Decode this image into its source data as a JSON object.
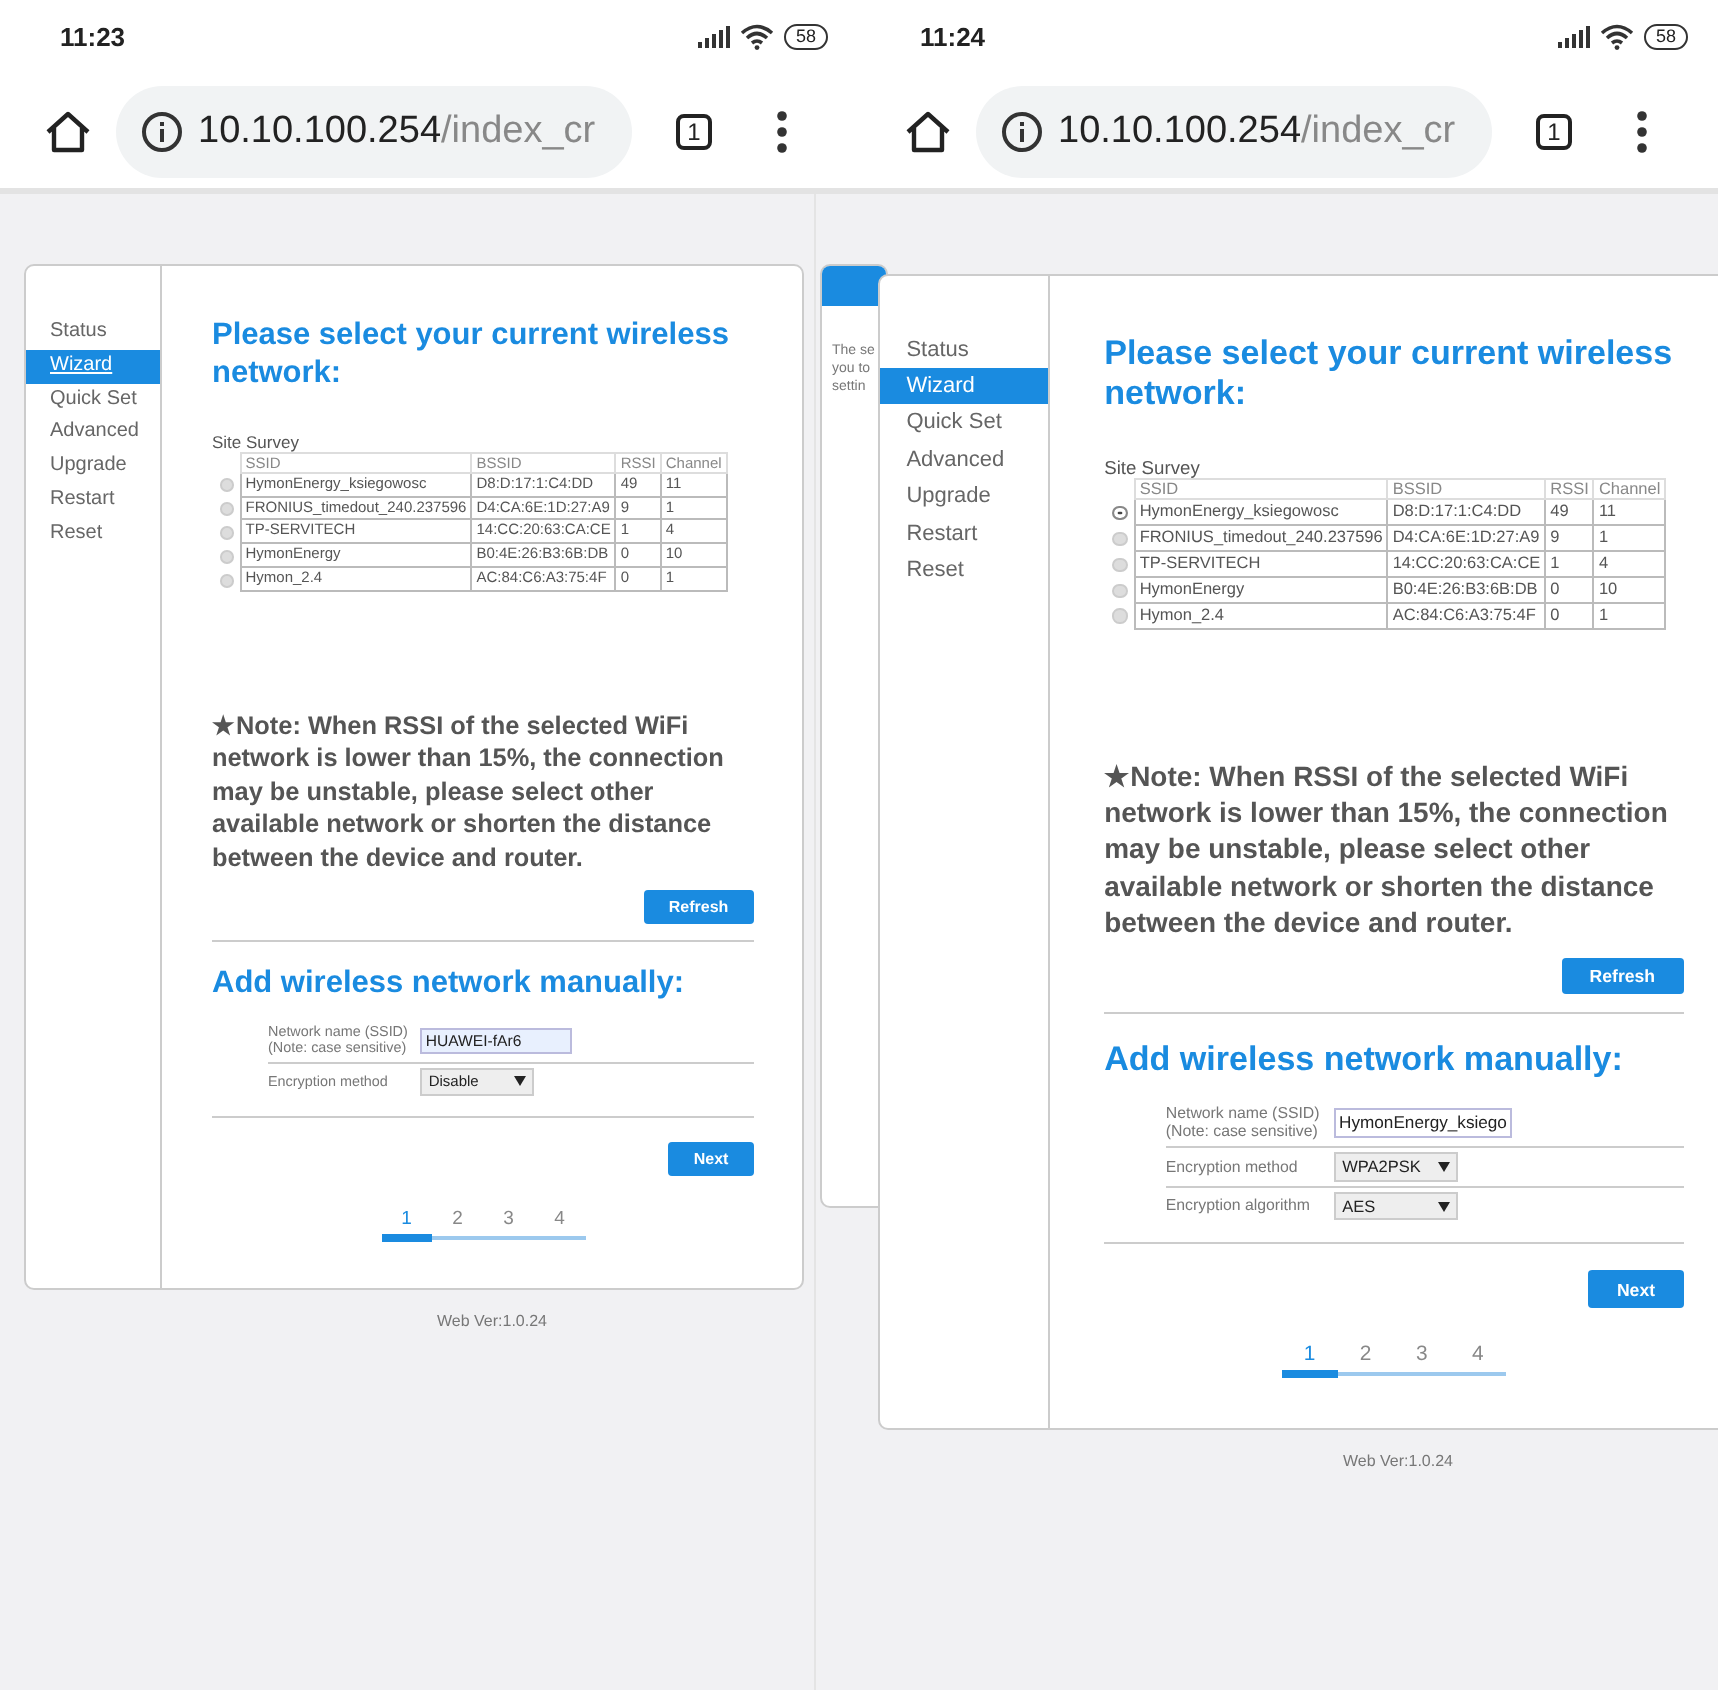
{
  "phones": [
    {
      "status_bar": {
        "time": "11:23",
        "battery": "58"
      },
      "address_bar": {
        "host": "10.10.100.254",
        "path": "/index_cr",
        "tab_count": "1"
      },
      "sidebar": {
        "items": [
          {
            "label": "Status",
            "selected": false
          },
          {
            "label": "Wizard",
            "selected": true
          },
          {
            "label": "Quick Set",
            "selected": false
          },
          {
            "label": "Advanced",
            "selected": false
          },
          {
            "label": "Upgrade",
            "selected": false
          },
          {
            "label": "Restart",
            "selected": false
          },
          {
            "label": "Reset",
            "selected": false
          }
        ]
      },
      "survey": {
        "title": "Please select your current wireless network:",
        "table_title": "Site Survey",
        "columns": [
          "SSID",
          "BSSID",
          "RSSI",
          "Channel"
        ],
        "rows": [
          {
            "selected": false,
            "cells": [
              "HymonEnergy_ksiegowosc",
              "D8:D:17:1:C4:DD",
              "49",
              "11"
            ]
          },
          {
            "selected": false,
            "cells": [
              "FRONIUS_timedout_240.237596",
              "D4:CA:6E:1D:27:A9",
              "9",
              "1"
            ]
          },
          {
            "selected": false,
            "cells": [
              "TP-SERVITECH",
              "14:CC:20:63:CA:CE",
              "1",
              "4"
            ]
          },
          {
            "selected": false,
            "cells": [
              "HymonEnergy",
              "B0:4E:26:B3:6B:DB",
              "0",
              "10"
            ]
          },
          {
            "selected": false,
            "cells": [
              "Hymon_2.4",
              "AC:84:C6:A3:75:4F",
              "0",
              "1"
            ]
          }
        ]
      },
      "note": "★Note: When RSSI of the selected WiFi network is lower than 15%, the connection may be unstable, please select other available network or shorten the distance between the device and router.",
      "refresh_button": "Refresh",
      "manual": {
        "title": "Add wireless network manually:",
        "fields": [
          {
            "kind": "input",
            "label": "Network name (SSID)",
            "sublabel": "(Note: case sensitive)",
            "value": "HUAWEI-fAr6"
          },
          {
            "kind": "select",
            "label": "Encryption method",
            "value": "Disable"
          }
        ]
      },
      "next_button": "Next",
      "steps": [
        {
          "label": "1",
          "selected": true
        },
        {
          "label": "2",
          "selected": false
        },
        {
          "label": "3",
          "selected": false
        },
        {
          "label": "4",
          "selected": false
        }
      ],
      "footer": "Web Ver:1.0.24"
    },
    {
      "status_bar": {
        "time": "11:24",
        "battery": "58"
      },
      "address_bar": {
        "host": "10.10.100.254",
        "path": "/index_cr",
        "tab_count": "1"
      },
      "peek_card": {
        "lines": [
          "The se",
          "you to",
          "settin"
        ]
      },
      "sidebar": {
        "items": [
          {
            "label": "Status",
            "selected": false
          },
          {
            "label": "Wizard",
            "selected": true
          },
          {
            "label": "Quick Set",
            "selected": false
          },
          {
            "label": "Advanced",
            "selected": false
          },
          {
            "label": "Upgrade",
            "selected": false
          },
          {
            "label": "Restart",
            "selected": false
          },
          {
            "label": "Reset",
            "selected": false
          }
        ]
      },
      "survey": {
        "title": "Please select your current wireless network:",
        "table_title": "Site Survey",
        "columns": [
          "SSID",
          "BSSID",
          "RSSI",
          "Channel"
        ],
        "rows": [
          {
            "selected": true,
            "cells": [
              "HymonEnergy_ksiegowosc",
              "D8:D:17:1:C4:DD",
              "49",
              "11"
            ]
          },
          {
            "selected": false,
            "cells": [
              "FRONIUS_timedout_240.237596",
              "D4:CA:6E:1D:27:A9",
              "9",
              "1"
            ]
          },
          {
            "selected": false,
            "cells": [
              "TP-SERVITECH",
              "14:CC:20:63:CA:CE",
              "1",
              "4"
            ]
          },
          {
            "selected": false,
            "cells": [
              "HymonEnergy",
              "B0:4E:26:B3:6B:DB",
              "0",
              "10"
            ]
          },
          {
            "selected": false,
            "cells": [
              "Hymon_2.4",
              "AC:84:C6:A3:75:4F",
              "0",
              "1"
            ]
          }
        ]
      },
      "note": "★Note: When RSSI of the selected WiFi network is lower than 15%, the connection may be unstable, please select other available network or shorten the distance between the device and router.",
      "refresh_button": "Refresh",
      "manual": {
        "title": "Add wireless network manually:",
        "fields": [
          {
            "kind": "input",
            "label": "Network name (SSID)",
            "sublabel": "(Note: case sensitive)",
            "value": "HymonEnergy_ksiego"
          },
          {
            "kind": "select",
            "label": "Encryption method",
            "value": "WPA2PSK"
          },
          {
            "kind": "select",
            "label": "Encryption algorithm",
            "value": "AES"
          }
        ]
      },
      "next_button": "Next",
      "steps": [
        {
          "label": "1",
          "selected": true
        },
        {
          "label": "2",
          "selected": false
        },
        {
          "label": "3",
          "selected": false
        },
        {
          "label": "4",
          "selected": false
        }
      ],
      "footer": "Web Ver:1.0.24"
    }
  ]
}
